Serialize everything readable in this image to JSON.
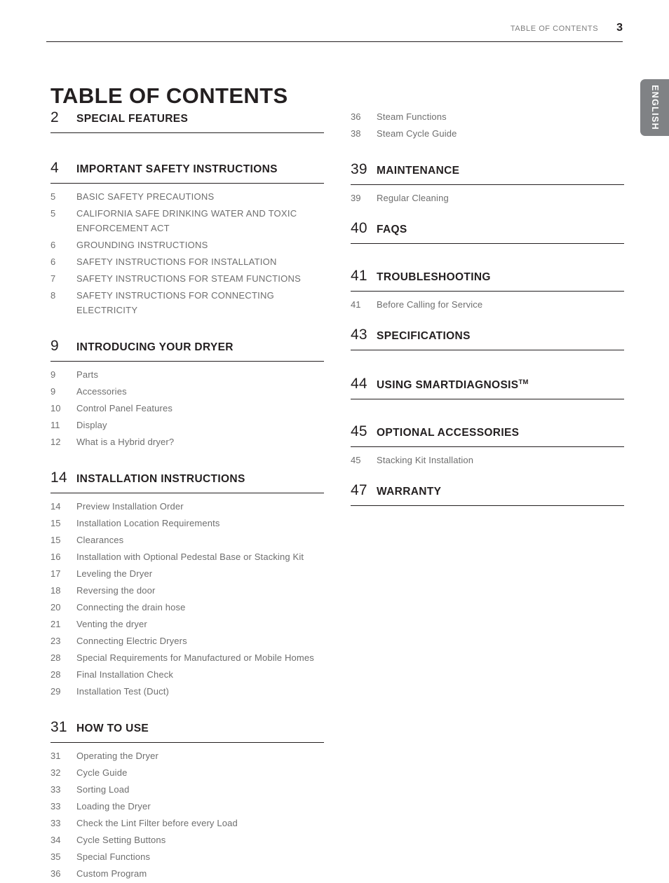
{
  "header": {
    "label": "TABLE OF CONTENTS",
    "page_number": "3"
  },
  "side_tab": {
    "label": "ENGLISH",
    "color": "#808285"
  },
  "title": "TABLE OF CONTENTS",
  "left_column": [
    {
      "number": "2",
      "title": "SPECIAL FEATURES",
      "entries": []
    },
    {
      "number": "4",
      "title": "IMPORTANT SAFETY INSTRUCTIONS",
      "caps": true,
      "entries": [
        {
          "page": "5",
          "text": "BASIC SAFETY PRECAUTIONS"
        },
        {
          "page": "5",
          "text": "CALIFORNIA SAFE DRINKING WATER AND TOXIC ENFORCEMENT ACT"
        },
        {
          "page": "6",
          "text": "GROUNDING INSTRUCTIONS"
        },
        {
          "page": "6",
          "text": "SAFETY INSTRUCTIONS FOR INSTALLATION"
        },
        {
          "page": "7",
          "text": "SAFETY INSTRUCTIONS FOR STEAM FUNCTIONS"
        },
        {
          "page": "8",
          "text": "SAFETY INSTRUCTIONS FOR CONNECTING ELECTRICITY"
        }
      ]
    },
    {
      "number": "9",
      "title": "INTRODUCING YOUR DRYER",
      "entries": [
        {
          "page": "9",
          "text": "Parts"
        },
        {
          "page": "9",
          "text": "Accessories"
        },
        {
          "page": "10",
          "text": "Control Panel Features"
        },
        {
          "page": "11",
          "text": "Display"
        },
        {
          "page": "12",
          "text": "What is a Hybrid dryer?"
        }
      ]
    },
    {
      "number": "14",
      "title": "INSTALLATION INSTRUCTIONS",
      "entries": [
        {
          "page": "14",
          "text": "Preview Installation Order"
        },
        {
          "page": "15",
          "text": "Installation Location Requirements"
        },
        {
          "page": "15",
          "text": "Clearances"
        },
        {
          "page": "16",
          "text": "Installation with Optional Pedestal Base or Stacking Kit"
        },
        {
          "page": "17",
          "text": "Leveling the Dryer"
        },
        {
          "page": "18",
          "text": "Reversing the door"
        },
        {
          "page": "20",
          "text": "Connecting  the drain hose"
        },
        {
          "page": "21",
          "text": "Venting the dryer"
        },
        {
          "page": "23",
          "text": "Connecting Electric Dryers"
        },
        {
          "page": "28",
          "text": "Special Requirements for Manufactured or Mobile Homes"
        },
        {
          "page": "28",
          "text": "Final Installation Check"
        },
        {
          "page": "29",
          "text": "Installation Test (Duct)"
        }
      ]
    },
    {
      "number": "31",
      "title": "HOW TO USE",
      "entries": [
        {
          "page": "31",
          "text": "Operating the Dryer"
        },
        {
          "page": "32",
          "text": "Cycle Guide"
        },
        {
          "page": "33",
          "text": "Sorting Load"
        },
        {
          "page": "33",
          "text": "Loading the Dryer"
        },
        {
          "page": "33",
          "text": "Check the Lint Filter before every Load"
        },
        {
          "page": "34",
          "text": "Cycle Setting Buttons"
        },
        {
          "page": "35",
          "text": "Special Functions"
        },
        {
          "page": "36",
          "text": "Custom Program"
        }
      ]
    }
  ],
  "right_column_continued": [
    {
      "page": "36",
      "text": "Steam Functions"
    },
    {
      "page": "38",
      "text": "Steam Cycle Guide"
    }
  ],
  "right_column": [
    {
      "number": "39",
      "title": "MAINTENANCE",
      "entries": [
        {
          "page": "39",
          "text": "Regular Cleaning"
        }
      ]
    },
    {
      "number": "40",
      "title": "FAQS",
      "entries": []
    },
    {
      "number": "41",
      "title": "TROUBLESHOOTING",
      "entries": [
        {
          "page": "41",
          "text": "Before Calling for Service"
        }
      ]
    },
    {
      "number": "43",
      "title": "SPECIFICATIONS",
      "entries": []
    },
    {
      "number": "44",
      "title": "USING SMARTDIAGNOSIS",
      "superscript": "TM",
      "entries": []
    },
    {
      "number": "45",
      "title": "OPTIONAL ACCESSORIES",
      "entries": [
        {
          "page": "45",
          "text": "Stacking Kit Installation"
        }
      ]
    },
    {
      "number": "47",
      "title": "WARRANTY",
      "entries": []
    }
  ]
}
